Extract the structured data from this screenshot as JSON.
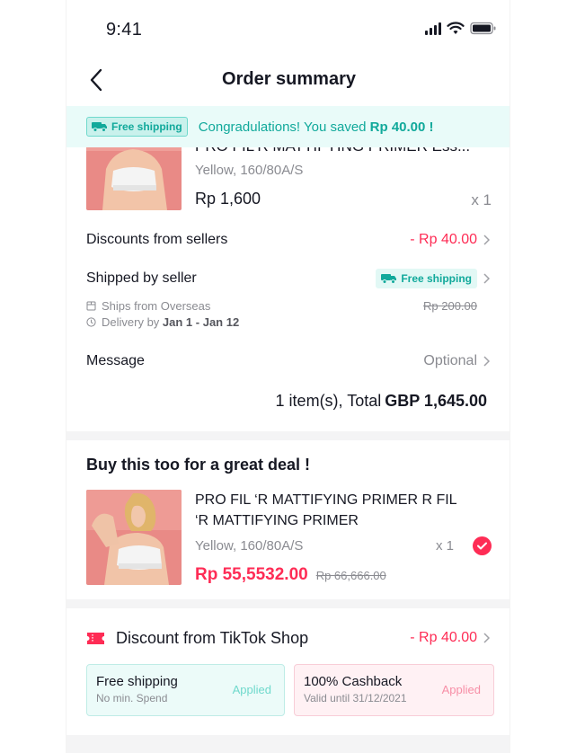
{
  "status_bar": {
    "time": "9:41"
  },
  "nav": {
    "title": "Order summary"
  },
  "banner": {
    "tag": "Free shipping",
    "text_prefix": "Congradulations!  You saved ",
    "amount": "Rp 40.00 !"
  },
  "order_item": {
    "name": "PRO FIL'R MATTIFYING PRIMER Ess...",
    "variant": "Yellow, 160/80A/S",
    "price": "Rp 1,600",
    "qty": "x 1"
  },
  "discounts": {
    "label": "Discounts from sellers",
    "value": "- Rp 40.00"
  },
  "shipping": {
    "label": "Shipped by seller",
    "tag": "Free shipping",
    "origin": "Ships from Overseas",
    "delivery_prefix": "Delivery by ",
    "delivery_range": "Jan 1 - Jan 12",
    "original_fee": "Rp 200.00"
  },
  "message": {
    "label": "Message",
    "placeholder": "Optional"
  },
  "total": {
    "prefix": "1 item(s), Total",
    "amount": "GBP 1,645.00"
  },
  "upsell": {
    "title": "Buy this too for a great deal !",
    "name_line1": "PRO FIL ‘R MATTIFYING PRIMER R FIL",
    "name_line2": "‘R MATTIFYING PRIMER",
    "variant": "Yellow, 160/80A/S",
    "qty": "x 1",
    "price": "Rp 55,5532.00",
    "original_price": "Rp 66,666.00",
    "selected": true
  },
  "shop_discount": {
    "title": "Discount from TikTok Shop",
    "value": "- Rp 40.00",
    "vouchers": [
      {
        "title": "Free shipping",
        "subtitle": "No min. Spend",
        "status": "Applied"
      },
      {
        "title": "100% Cashback",
        "subtitle": "Valid until 31/12/2021",
        "status": "Applied"
      }
    ]
  },
  "colors": {
    "accent_red": "#fe2c55",
    "accent_teal": "#11a99b",
    "banner_bg": "#e9fbf9",
    "text_primary": "#161823",
    "text_muted": "#8a8b91"
  },
  "icons": [
    "back-icon",
    "signal-icon",
    "wifi-icon",
    "battery-icon",
    "truck-icon",
    "package-icon",
    "clock-icon",
    "chevron-right-icon",
    "check-icon",
    "ticket-icon"
  ]
}
